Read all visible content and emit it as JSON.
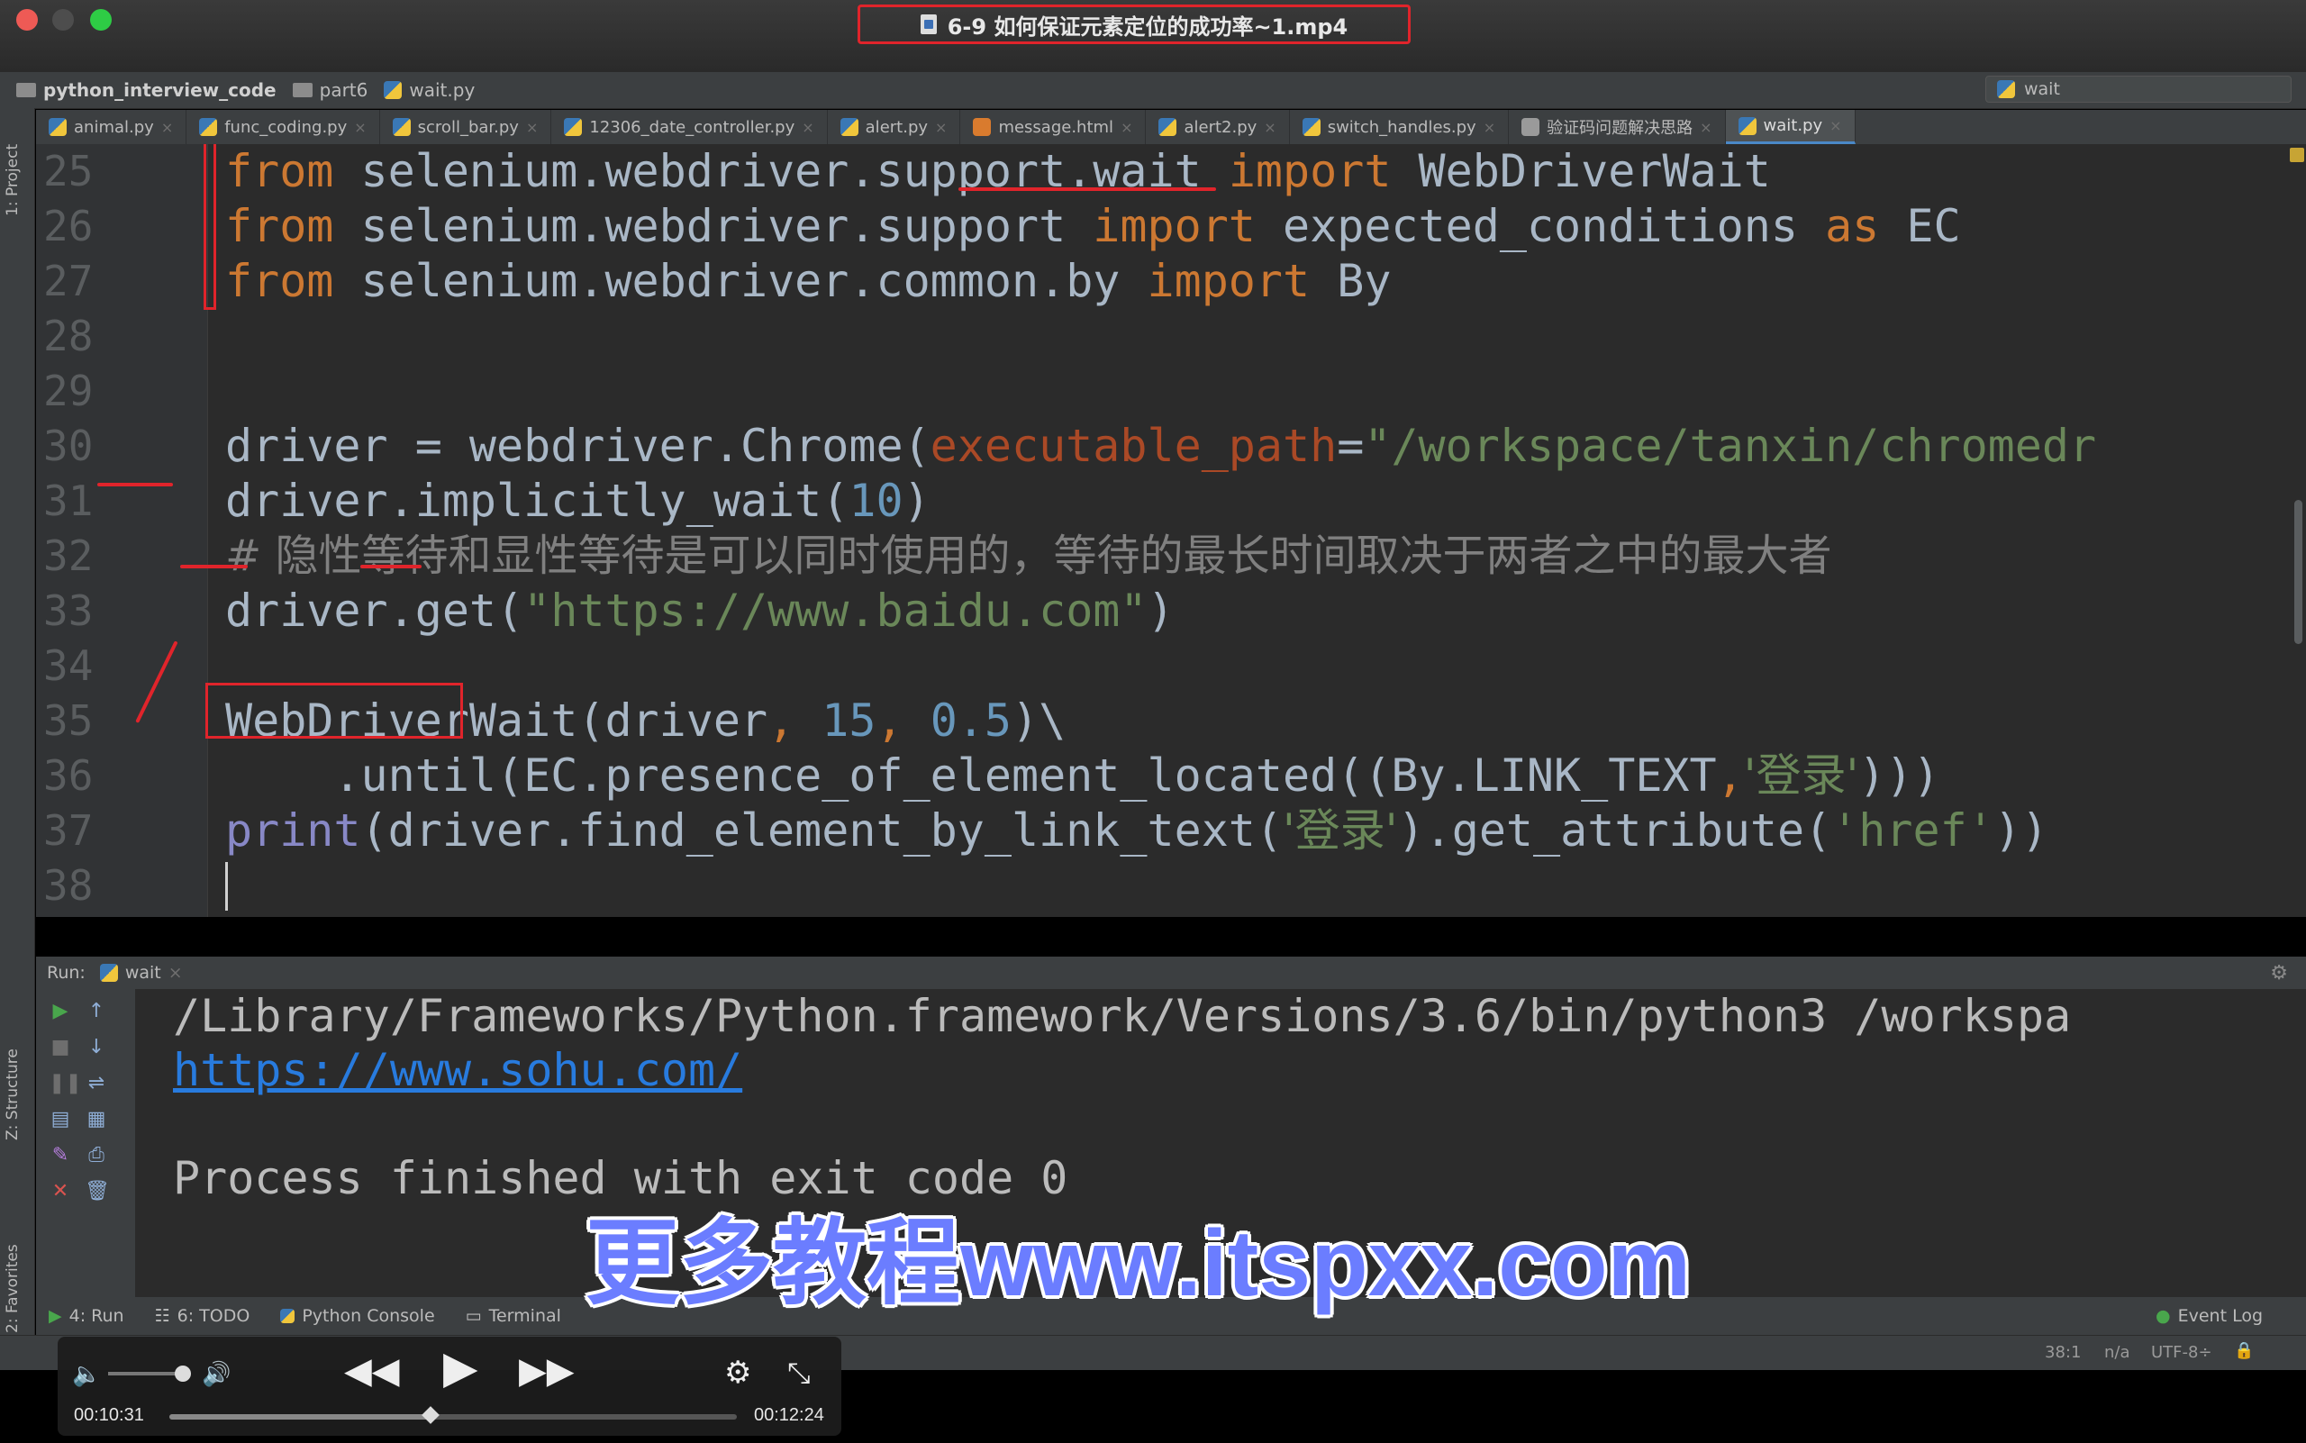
{
  "window": {
    "title": "6-9 如何保证元素定位的成功率~1.mp4"
  },
  "navbar": {
    "project": "python_interview_code",
    "folder": "part6",
    "file": "wait.py",
    "run_config": "wait"
  },
  "tabs": [
    {
      "label": "animal.py"
    },
    {
      "label": "func_coding.py"
    },
    {
      "label": "scroll_bar.py"
    },
    {
      "label": "12306_date_controller.py"
    },
    {
      "label": "alert.py"
    },
    {
      "label": "message.html"
    },
    {
      "label": "alert2.py"
    },
    {
      "label": "switch_handles.py"
    },
    {
      "label": "验证码问题解决思路"
    },
    {
      "label": "wait.py",
      "active": true
    }
  ],
  "sidebar": {
    "project": "1: Project",
    "structure": "Z: Structure",
    "favorites": "2: Favorites"
  },
  "editor": {
    "line_numbers": [
      "25",
      "26",
      "27",
      "28",
      "29",
      "30",
      "31",
      "32",
      "33",
      "34",
      "35",
      "36",
      "37",
      "38"
    ],
    "lines": {
      "l25": {
        "kw1": "from",
        "mod": " selenium.webdriver.support.wait ",
        "kw2": "import",
        "name": " WebDriverWait"
      },
      "l26": {
        "kw1": "from",
        "mod": " selenium.webdriver.support ",
        "kw2": "import",
        "name": " expected_conditions ",
        "kw3": "as",
        "alias": " EC"
      },
      "l27": {
        "kw1": "from",
        "mod": " selenium.webdriver.common.by ",
        "kw2": "import",
        "name": " By"
      },
      "l30": {
        "a": "driver = webdriver.Chrome(",
        "param": "executable_path",
        "eq": "=",
        "str": "\"/workspace/tanxin/chromedr"
      },
      "l31": {
        "a": "driver.implicitly_wait(",
        "num": "10",
        "b": ")"
      },
      "l32": {
        "comment": "# 隐性等待和显性等待是可以同时使用的，等待的最长时间取决于两者之中的最大者"
      },
      "l33": {
        "a": "driver.get(",
        "str": "\"https://www.baidu.com\"",
        "b": ")"
      },
      "l35": {
        "cls": "WebDriverWait",
        "a": "(driver",
        "c1": ",",
        "n1": " 15",
        "c2": ",",
        "n2": " 0.5",
        "b": ")\\"
      },
      "l36": {
        "a": "    .until(EC.presence_of_element_located((By.LINK_TEXT",
        "c": ",",
        "str": "'登录'",
        "b": ")))"
      },
      "l37": {
        "builtin": "print",
        "a": "(driver.find_element_by_link_text(",
        "s1": "'登录'",
        "b": ").get_attribute(",
        "s2": "'href'",
        "c": "))"
      }
    }
  },
  "run_panel": {
    "label": "Run:",
    "tab": "wait",
    "output": [
      "/Library/Frameworks/Python.framework/Versions/3.6/bin/python3 /workspa",
      "https://www.sohu.com/",
      "",
      "Process finished with exit code 0"
    ]
  },
  "bottom_tools": {
    "run": "4: Run",
    "todo": "6: TODO",
    "console": "Python Console",
    "terminal": "Terminal",
    "event_log": "Event Log"
  },
  "status": {
    "position": "38:1",
    "line_sep": "n/a",
    "encoding": "UTF-8÷"
  },
  "watermark": "更多教程www.itspxx.com",
  "player": {
    "elapsed": "00:10:31",
    "remaining": "00:12:24",
    "progress": 0.46,
    "volume": 0.85
  }
}
